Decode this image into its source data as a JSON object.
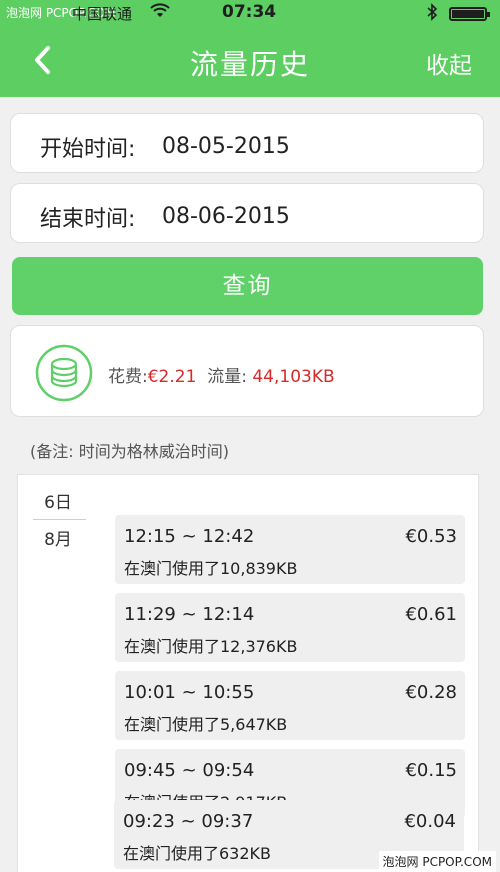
{
  "status_bar": {
    "watermark": "泡泡网 PCPOP.COM",
    "carrier": "中国联通",
    "time": "07:34"
  },
  "nav": {
    "title": "流量历史",
    "collapse_label": "收起"
  },
  "form": {
    "start_label": "开始时间:",
    "start_value": "08-05-2015",
    "end_label": "结束时间:",
    "end_value": "08-06-2015",
    "query_label": "查询"
  },
  "summary": {
    "cost_label": "花费:",
    "cost_value": "€2.21",
    "traffic_label": "流量:",
    "traffic_value": "44,103KB"
  },
  "note": "(备注: 时间为格林威治时间)",
  "history": {
    "day": "6日",
    "month": "8月",
    "entries": [
      {
        "range": "12:15 ~ 12:42",
        "cost": "€0.53",
        "usage": "在澳门使用了10,839KB"
      },
      {
        "range": "11:29 ~ 12:14",
        "cost": "€0.61",
        "usage": "在澳门使用了12,376KB"
      },
      {
        "range": "10:01 ~ 10:55",
        "cost": "€0.28",
        "usage": "在澳门使用了5,647KB"
      },
      {
        "range": "09:45 ~ 09:54",
        "cost": "€0.15",
        "usage": "在澳门使用了2,917KB"
      },
      {
        "range": "09:23 ~ 09:37",
        "cost": "€0.04",
        "usage": "在澳门使用了632KB"
      }
    ]
  },
  "footer_watermark": "泡泡网 PCPOP.COM",
  "colors": {
    "accent": "#5dcf62",
    "price_red": "#d82a2a"
  }
}
